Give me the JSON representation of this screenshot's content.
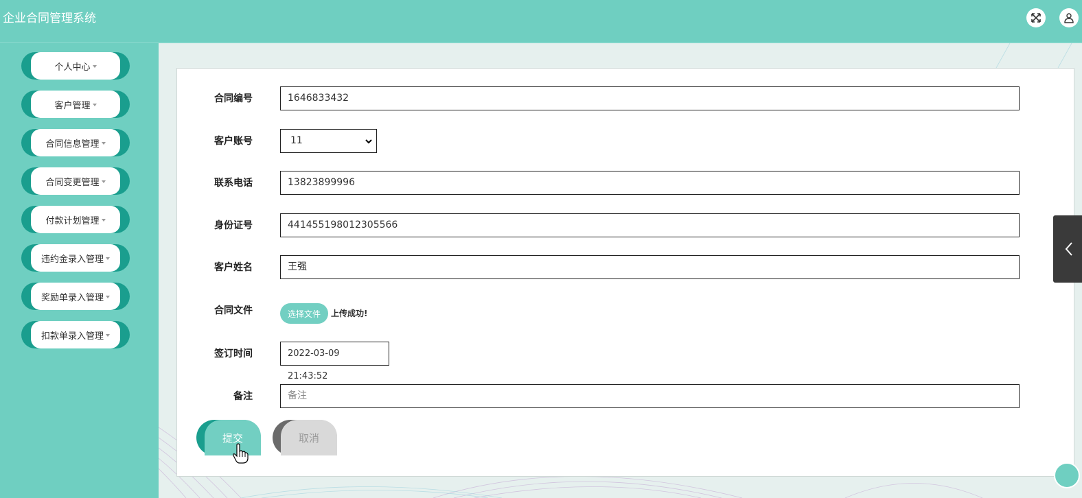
{
  "app": {
    "title": "企业合同管理系统"
  },
  "header": {
    "icons": [
      "fullscreen-icon",
      "user-icon"
    ]
  },
  "sidebar": {
    "items": [
      {
        "label": "个人中心"
      },
      {
        "label": "客户管理"
      },
      {
        "label": "合同信息管理"
      },
      {
        "label": "合同变更管理"
      },
      {
        "label": "付款计划管理"
      },
      {
        "label": "违约金录入管理"
      },
      {
        "label": "奖励单录入管理"
      },
      {
        "label": "扣款单录入管理"
      }
    ]
  },
  "form": {
    "contract_no": {
      "label": "合同编号",
      "value": "1646833432"
    },
    "customer_account": {
      "label": "客户账号",
      "value": "11"
    },
    "phone": {
      "label": "联系电话",
      "value": "13823899996"
    },
    "id_number": {
      "label": "身份证号",
      "value": "441455198012305566"
    },
    "customer_name": {
      "label": "客户姓名",
      "value": "王强"
    },
    "contract_file": {
      "label": "合同文件",
      "button": "选择文件",
      "status": "上传成功!"
    },
    "sign_time": {
      "label": "签订时间",
      "value": "2022-03-09 21:43:52"
    },
    "remark": {
      "label": "备注",
      "placeholder": "备注"
    },
    "submit_label": "提交",
    "cancel_label": "取消"
  },
  "colors": {
    "primary": "#6fcfc1",
    "primary_dark": "#1a9e8e",
    "cancel": "#d9d9d9"
  }
}
